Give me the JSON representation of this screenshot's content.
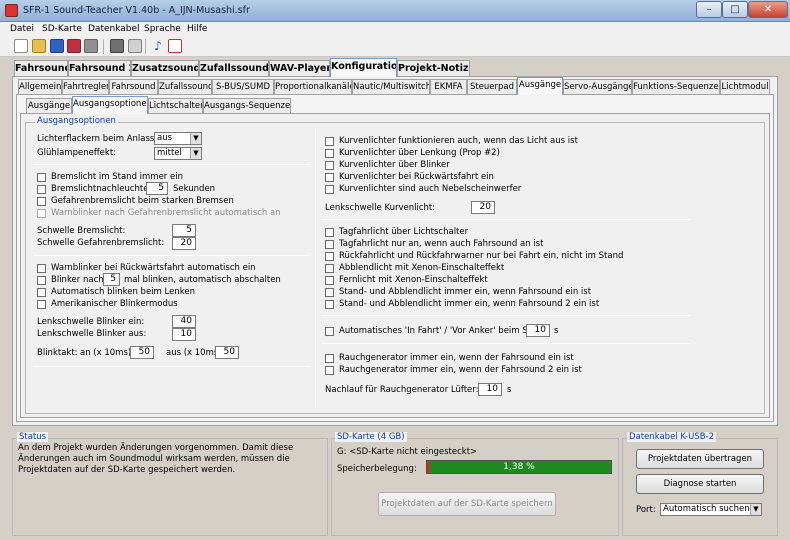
{
  "window": {
    "title": "SFR-1 Sound-Teacher V1.40b - A_IJN-Musashi.sfr",
    "min": "–",
    "max": "□",
    "close": "✕"
  },
  "menu": [
    "Datei",
    "SD-Karte",
    "Datenkabel",
    "Sprache",
    "Hilfe"
  ],
  "toolbar": [
    "new-icon",
    "open-icon",
    "save-icon",
    "save-as-icon",
    "print-icon",
    "calculator-icon",
    "grid-icon",
    "music-icon",
    "help-icon"
  ],
  "main_tabs": [
    "Fahrsound",
    "Fahrsound 2",
    "Zusatzsounds",
    "Zufallssounds",
    "WAV-Player",
    "Konfiguration",
    "Projekt-Notizen"
  ],
  "main_active": "Konfiguration",
  "sub_tabs": [
    "Allgemein",
    "Fahrtregler",
    "Fahrsound",
    "Zufallssound",
    "S-BUS/SUMD",
    "Proportionalkanäle",
    "Nautic/Multiswitch",
    "EKMFA",
    "Steuerpad",
    "Ausgänge",
    "Servo-Ausgänge",
    "Funktions-Sequenzen",
    "Lichtmodul"
  ],
  "sub_active": "Ausgänge",
  "sub2_tabs": [
    "Ausgänge",
    "Ausgangsoptionen",
    "Lichtschalter",
    "Ausgangs-Sequenzen"
  ],
  "sub2_active": "Ausgangsoptionen",
  "group_title": "Ausgangsoptionen",
  "left": {
    "flicker_label": "Lichterflackern beim Anlassen:",
    "flicker_value": "aus",
    "bulb_label": "Glühlampeneffekt:",
    "bulb_value": "mittel",
    "brake_stand": "Bremslicht im Stand immer ein",
    "brake_after": "Bremslichtnachleuchten:",
    "brake_after_value": "5",
    "brake_after_unit": "Sekunden",
    "hazard_brake": "Gefahrenbremslicht beim starken Bremsen",
    "hazard_auto": "Warnblinker nach Gefahrenbremslicht automatisch an",
    "thr_brake_label": "Schwelle Bremslicht:",
    "thr_brake_value": "5",
    "thr_hazard_label": "Schwelle Gefahrenbremslicht:",
    "thr_hazard_value": "20",
    "warn_reverse": "Warnblinker bei Rückwärtsfahrt automatisch ein",
    "blink_after_a": "Blinker nach",
    "blink_after_value": "5",
    "blink_after_b": "mal blinken, automatisch abschalten",
    "blink_steer": "Automatisch blinken beim Lenken",
    "us_blinker": "Amerikanischer Blinkermodus",
    "steer_on_label": "Lenkschwelle Blinker ein:",
    "steer_on_value": "40",
    "steer_off_label": "Lenkschwelle Blinker aus:",
    "steer_off_value": "10",
    "blinktakt_label": "Blinktakt:",
    "on_label": "an (x 10ms):",
    "on_value": "50",
    "off_label": "aus (x 10ms):",
    "off_value": "50"
  },
  "right": {
    "curve": [
      "Kurvenlichter funktionieren auch, wenn das Licht aus ist",
      "Kurvenlichter über Lenkung (Prop #2)",
      "Kurvenlichter über Blinker",
      "Kurvenlichter bei Rückwärtsfahrt ein",
      "Kurvenlichter sind auch Nebelscheinwerfer"
    ],
    "curve_thr_label": "Lenkschwelle Kurvenlicht:",
    "curve_thr_value": "20",
    "day": [
      "Tagfahrlicht über Lichtschalter",
      "Tagfahrlicht nur an, wenn auch Fahrsound an ist",
      "Rückfahrlicht und Rückfahrwarner nur bei Fahrt ein, nicht im Stand",
      "Abblendlicht mit Xenon-Einschalteffekt",
      "Fernlicht mit Xenon-Einschalteffekt",
      "Stand- und Abblendlicht immer ein, wenn Fahrsound ein ist",
      "Stand- und Abblendlicht immer ein, wenn Fahrsound 2 ein ist"
    ],
    "ship_label": "Automatisches 'In Fahrt' / 'Vor Anker' beim Schiff:",
    "ship_value": "10",
    "ship_unit": "s",
    "smoke": [
      "Rauchgenerator immer ein, wenn der Fahrsound ein ist",
      "Rauchgenerator immer ein, wenn der Fahrsound 2 ein ist"
    ],
    "fan_label": "Nachlauf für Rauchgenerator Lüfter:",
    "fan_value": "10",
    "fan_unit": "s"
  },
  "status": {
    "title": "Status",
    "text": "An dem Projekt wurden Änderungen vorgenommen. Damit diese Änderungen auch im Soundmodul wirksam werden, müssen die Projektdaten auf der SD-Karte gespeichert werden."
  },
  "sd": {
    "title": "SD-Karte (4 GB)",
    "card": "G:  <SD-Karte nicht eingesteckt>",
    "usage_label": "Speicherbelegung:",
    "usage_text": "1,38 %",
    "usage_pct": 1.38,
    "save_button": "Projektdaten auf der SD-Karte speichern"
  },
  "cable": {
    "title": "Datenkabel K-USB-2",
    "transfer_button": "Projektdaten übertragen",
    "diag_button": "Diagnose starten",
    "port_label": "Port:",
    "port_value": "Automatisch suchen"
  },
  "colors": {
    "progress": "#1e8a1e",
    "group_title": "#1040a0"
  }
}
